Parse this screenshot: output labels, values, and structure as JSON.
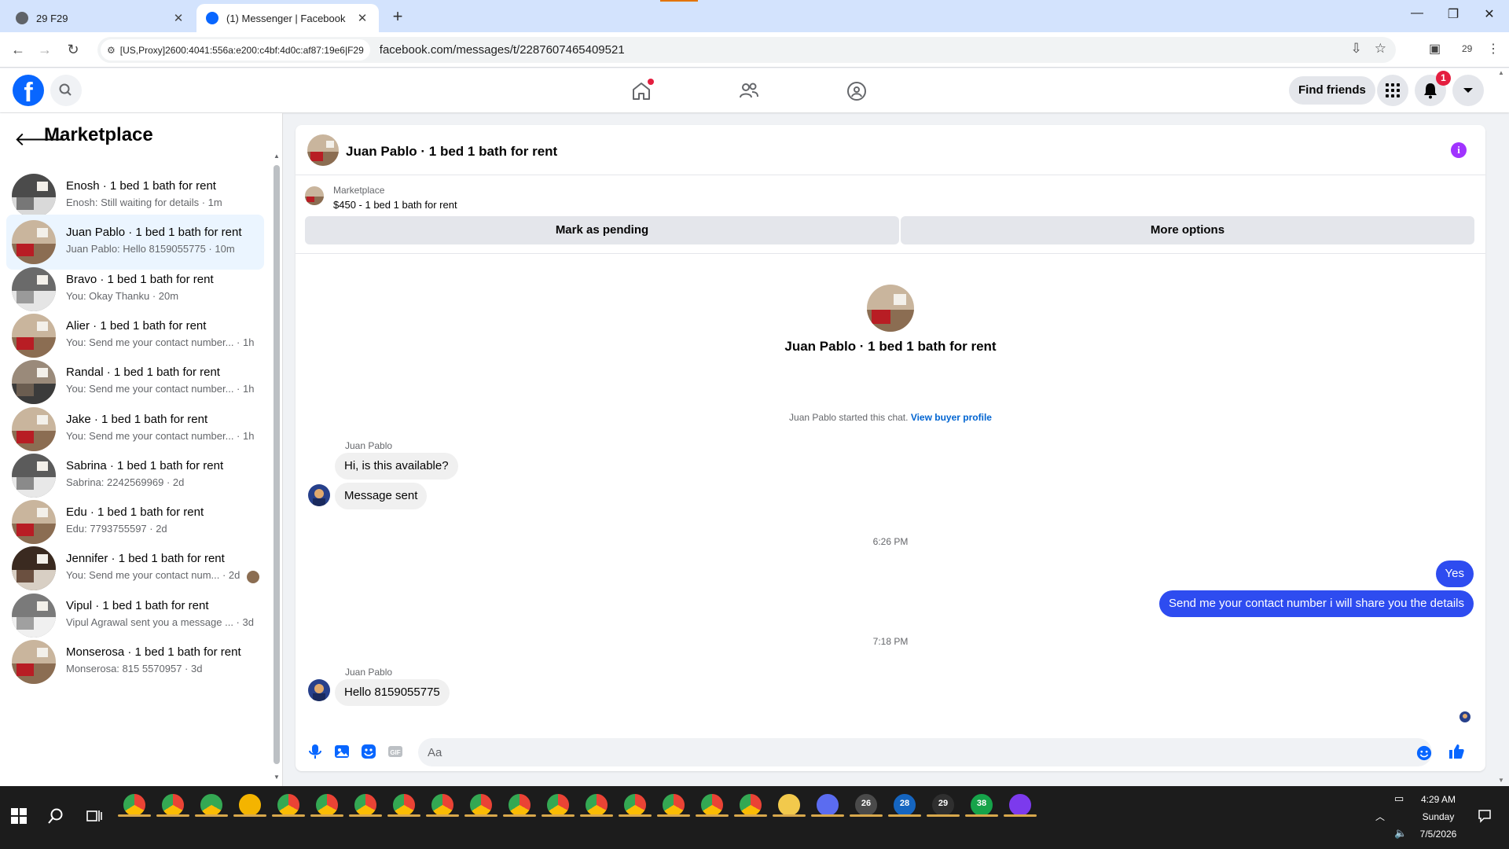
{
  "browser": {
    "tabs": [
      {
        "title": "29 F29",
        "active": false
      },
      {
        "title": "(1) Messenger | Facebook",
        "active": true
      }
    ],
    "proxy_chip": "[US,Proxy]2600:4041:556a:e200:c4bf:4d0c:af87:19e6|F29",
    "url": "facebook.com/messages/t/2287607465409521",
    "profile_label": "29"
  },
  "fb_header": {
    "find_friends": "Find friends",
    "notification_count": "1"
  },
  "left_panel": {
    "title": "Marketplace",
    "conversations": [
      {
        "name": "Enosh · 1 bed 1 bath for rent",
        "preview": "Enosh: Still waiting for details · 1m",
        "selected": false
      },
      {
        "name": "Juan Pablo · 1 bed 1 bath for rent",
        "preview": "Juan Pablo: Hello 8159055775 · 10m",
        "selected": true
      },
      {
        "name": "Bravo · 1 bed 1 bath for rent",
        "preview": "You: Okay Thanku · 20m",
        "selected": false
      },
      {
        "name": "Alier · 1 bed 1 bath for rent",
        "preview": "You: Send me your contact number... · 1h",
        "selected": false
      },
      {
        "name": "Randal · 1 bed 1 bath for rent",
        "preview": "You: Send me your contact number... · 1h",
        "selected": false
      },
      {
        "name": "Jake · 1 bed 1 bath for rent",
        "preview": "You: Send me your contact number... · 1h",
        "selected": false
      },
      {
        "name": "Sabrina · 1 bed 1 bath for rent",
        "preview": "Sabrina: 2242569969 · 2d",
        "selected": false
      },
      {
        "name": "Edu · 1 bed 1 bath for rent",
        "preview": "Edu: 7793755597 · 2d",
        "selected": false
      },
      {
        "name": "Jennifer · 1 bed 1 bath for rent",
        "preview": "You: Send me your contact num... · 2d",
        "selected": false
      },
      {
        "name": "Vipul · 1 bed 1 bath for rent",
        "preview": "Vipul Agrawal sent you a message ... · 3d",
        "selected": false
      },
      {
        "name": "Monserosa · 1 bed 1 bath for rent",
        "preview": "Monserosa: 815 5570957 · 3d",
        "selected": false
      }
    ]
  },
  "chat": {
    "title": "Juan Pablo · 1 bed 1 bath for rent",
    "marketplace_label": "Marketplace",
    "listing": "$450 - 1 bed 1 bath for rent",
    "mark_pending": "Mark as pending",
    "more_options": "More options",
    "hero_name": "Juan Pablo · 1 bed 1 bath for rent",
    "started_text": "Juan Pablo started this chat.",
    "view_buyer": "View buyer profile",
    "sender1": "Juan Pablo",
    "msg1": "Hi, is this available?",
    "msg2": "Message sent",
    "time1": "6:26 PM",
    "out1": "Yes",
    "out2": "Send me your contact number i will share you the details",
    "time2": "7:18 PM",
    "sender2": "Juan Pablo",
    "msg3": "Hello 8159055775",
    "input_placeholder": "Aa"
  },
  "taskbar": {
    "badges": [
      "26",
      "28",
      "29",
      "38"
    ],
    "time": "4:29 AM",
    "day": "Sunday",
    "date": "7/5/2026"
  },
  "colors": {
    "fb_blue": "#0866ff",
    "outgoing_bubble": "#2e4cf0",
    "selected_row": "#ebf5ff",
    "notification_red": "#e41e3f"
  }
}
